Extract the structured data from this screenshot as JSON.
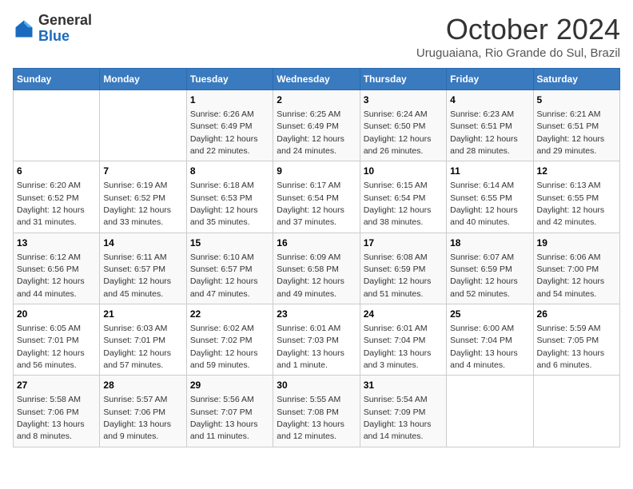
{
  "header": {
    "logo": {
      "general": "General",
      "blue": "Blue"
    },
    "title": "October 2024",
    "subtitle": "Uruguaiana, Rio Grande do Sul, Brazil"
  },
  "calendar": {
    "days_of_week": [
      "Sunday",
      "Monday",
      "Tuesday",
      "Wednesday",
      "Thursday",
      "Friday",
      "Saturday"
    ],
    "weeks": [
      [
        {
          "day": "",
          "sunrise": "",
          "sunset": "",
          "daylight": ""
        },
        {
          "day": "",
          "sunrise": "",
          "sunset": "",
          "daylight": ""
        },
        {
          "day": "1",
          "sunrise": "Sunrise: 6:26 AM",
          "sunset": "Sunset: 6:49 PM",
          "daylight": "Daylight: 12 hours and 22 minutes."
        },
        {
          "day": "2",
          "sunrise": "Sunrise: 6:25 AM",
          "sunset": "Sunset: 6:49 PM",
          "daylight": "Daylight: 12 hours and 24 minutes."
        },
        {
          "day": "3",
          "sunrise": "Sunrise: 6:24 AM",
          "sunset": "Sunset: 6:50 PM",
          "daylight": "Daylight: 12 hours and 26 minutes."
        },
        {
          "day": "4",
          "sunrise": "Sunrise: 6:23 AM",
          "sunset": "Sunset: 6:51 PM",
          "daylight": "Daylight: 12 hours and 28 minutes."
        },
        {
          "day": "5",
          "sunrise": "Sunrise: 6:21 AM",
          "sunset": "Sunset: 6:51 PM",
          "daylight": "Daylight: 12 hours and 29 minutes."
        }
      ],
      [
        {
          "day": "6",
          "sunrise": "Sunrise: 6:20 AM",
          "sunset": "Sunset: 6:52 PM",
          "daylight": "Daylight: 12 hours and 31 minutes."
        },
        {
          "day": "7",
          "sunrise": "Sunrise: 6:19 AM",
          "sunset": "Sunset: 6:52 PM",
          "daylight": "Daylight: 12 hours and 33 minutes."
        },
        {
          "day": "8",
          "sunrise": "Sunrise: 6:18 AM",
          "sunset": "Sunset: 6:53 PM",
          "daylight": "Daylight: 12 hours and 35 minutes."
        },
        {
          "day": "9",
          "sunrise": "Sunrise: 6:17 AM",
          "sunset": "Sunset: 6:54 PM",
          "daylight": "Daylight: 12 hours and 37 minutes."
        },
        {
          "day": "10",
          "sunrise": "Sunrise: 6:15 AM",
          "sunset": "Sunset: 6:54 PM",
          "daylight": "Daylight: 12 hours and 38 minutes."
        },
        {
          "day": "11",
          "sunrise": "Sunrise: 6:14 AM",
          "sunset": "Sunset: 6:55 PM",
          "daylight": "Daylight: 12 hours and 40 minutes."
        },
        {
          "day": "12",
          "sunrise": "Sunrise: 6:13 AM",
          "sunset": "Sunset: 6:55 PM",
          "daylight": "Daylight: 12 hours and 42 minutes."
        }
      ],
      [
        {
          "day": "13",
          "sunrise": "Sunrise: 6:12 AM",
          "sunset": "Sunset: 6:56 PM",
          "daylight": "Daylight: 12 hours and 44 minutes."
        },
        {
          "day": "14",
          "sunrise": "Sunrise: 6:11 AM",
          "sunset": "Sunset: 6:57 PM",
          "daylight": "Daylight: 12 hours and 45 minutes."
        },
        {
          "day": "15",
          "sunrise": "Sunrise: 6:10 AM",
          "sunset": "Sunset: 6:57 PM",
          "daylight": "Daylight: 12 hours and 47 minutes."
        },
        {
          "day": "16",
          "sunrise": "Sunrise: 6:09 AM",
          "sunset": "Sunset: 6:58 PM",
          "daylight": "Daylight: 12 hours and 49 minutes."
        },
        {
          "day": "17",
          "sunrise": "Sunrise: 6:08 AM",
          "sunset": "Sunset: 6:59 PM",
          "daylight": "Daylight: 12 hours and 51 minutes."
        },
        {
          "day": "18",
          "sunrise": "Sunrise: 6:07 AM",
          "sunset": "Sunset: 6:59 PM",
          "daylight": "Daylight: 12 hours and 52 minutes."
        },
        {
          "day": "19",
          "sunrise": "Sunrise: 6:06 AM",
          "sunset": "Sunset: 7:00 PM",
          "daylight": "Daylight: 12 hours and 54 minutes."
        }
      ],
      [
        {
          "day": "20",
          "sunrise": "Sunrise: 6:05 AM",
          "sunset": "Sunset: 7:01 PM",
          "daylight": "Daylight: 12 hours and 56 minutes."
        },
        {
          "day": "21",
          "sunrise": "Sunrise: 6:03 AM",
          "sunset": "Sunset: 7:01 PM",
          "daylight": "Daylight: 12 hours and 57 minutes."
        },
        {
          "day": "22",
          "sunrise": "Sunrise: 6:02 AM",
          "sunset": "Sunset: 7:02 PM",
          "daylight": "Daylight: 12 hours and 59 minutes."
        },
        {
          "day": "23",
          "sunrise": "Sunrise: 6:01 AM",
          "sunset": "Sunset: 7:03 PM",
          "daylight": "Daylight: 13 hours and 1 minute."
        },
        {
          "day": "24",
          "sunrise": "Sunrise: 6:01 AM",
          "sunset": "Sunset: 7:04 PM",
          "daylight": "Daylight: 13 hours and 3 minutes."
        },
        {
          "day": "25",
          "sunrise": "Sunrise: 6:00 AM",
          "sunset": "Sunset: 7:04 PM",
          "daylight": "Daylight: 13 hours and 4 minutes."
        },
        {
          "day": "26",
          "sunrise": "Sunrise: 5:59 AM",
          "sunset": "Sunset: 7:05 PM",
          "daylight": "Daylight: 13 hours and 6 minutes."
        }
      ],
      [
        {
          "day": "27",
          "sunrise": "Sunrise: 5:58 AM",
          "sunset": "Sunset: 7:06 PM",
          "daylight": "Daylight: 13 hours and 8 minutes."
        },
        {
          "day": "28",
          "sunrise": "Sunrise: 5:57 AM",
          "sunset": "Sunset: 7:06 PM",
          "daylight": "Daylight: 13 hours and 9 minutes."
        },
        {
          "day": "29",
          "sunrise": "Sunrise: 5:56 AM",
          "sunset": "Sunset: 7:07 PM",
          "daylight": "Daylight: 13 hours and 11 minutes."
        },
        {
          "day": "30",
          "sunrise": "Sunrise: 5:55 AM",
          "sunset": "Sunset: 7:08 PM",
          "daylight": "Daylight: 13 hours and 12 minutes."
        },
        {
          "day": "31",
          "sunrise": "Sunrise: 5:54 AM",
          "sunset": "Sunset: 7:09 PM",
          "daylight": "Daylight: 13 hours and 14 minutes."
        },
        {
          "day": "",
          "sunrise": "",
          "sunset": "",
          "daylight": ""
        },
        {
          "day": "",
          "sunrise": "",
          "sunset": "",
          "daylight": ""
        }
      ]
    ]
  }
}
